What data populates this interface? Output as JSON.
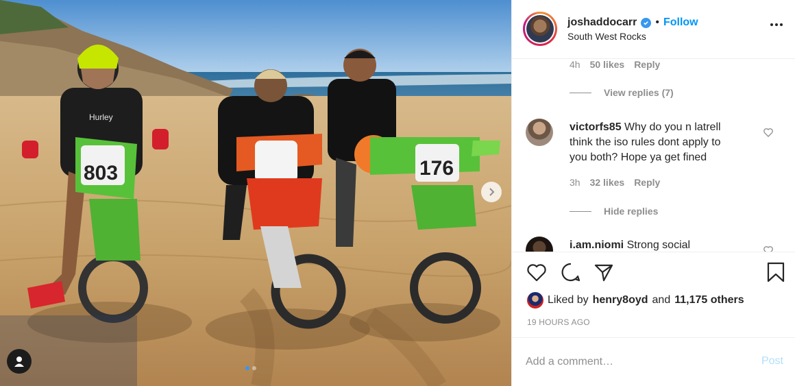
{
  "post": {
    "username": "joshaddocarr",
    "verified_icon": "verified-badge-icon",
    "separator": "•",
    "follow_label": "Follow",
    "location": "South West Rocks"
  },
  "comments": {
    "first_meta": {
      "time": "4h",
      "likes": "50 likes",
      "reply": "Reply"
    },
    "view_replies": "View replies (7)",
    "second": {
      "username": "victorfs85",
      "text_line1": "Why do you n latrell",
      "text_line2": "think the iso rules dont apply to",
      "text_line3": "you both? Hope ya get fined",
      "time": "3h",
      "likes": "32 likes",
      "reply": "Reply"
    },
    "hide_replies": "Hide replies",
    "third": {
      "username": "i.am.niomi",
      "text": "Strong social"
    }
  },
  "likes": {
    "prefix": "Liked by",
    "user": "henry8oyd",
    "conjunction": "and",
    "others": "11,175 others"
  },
  "timestamp": "19 HOURS AGO",
  "add_comment": {
    "placeholder": "Add a comment…",
    "post_label": "Post"
  },
  "colors": {
    "accent": "#0095f6",
    "post_disabled": "#b2dffc",
    "muted": "#8e8e8e",
    "text": "#262626"
  },
  "bike_numbers": [
    "803",
    "176"
  ],
  "jersey_text": "Hurley"
}
